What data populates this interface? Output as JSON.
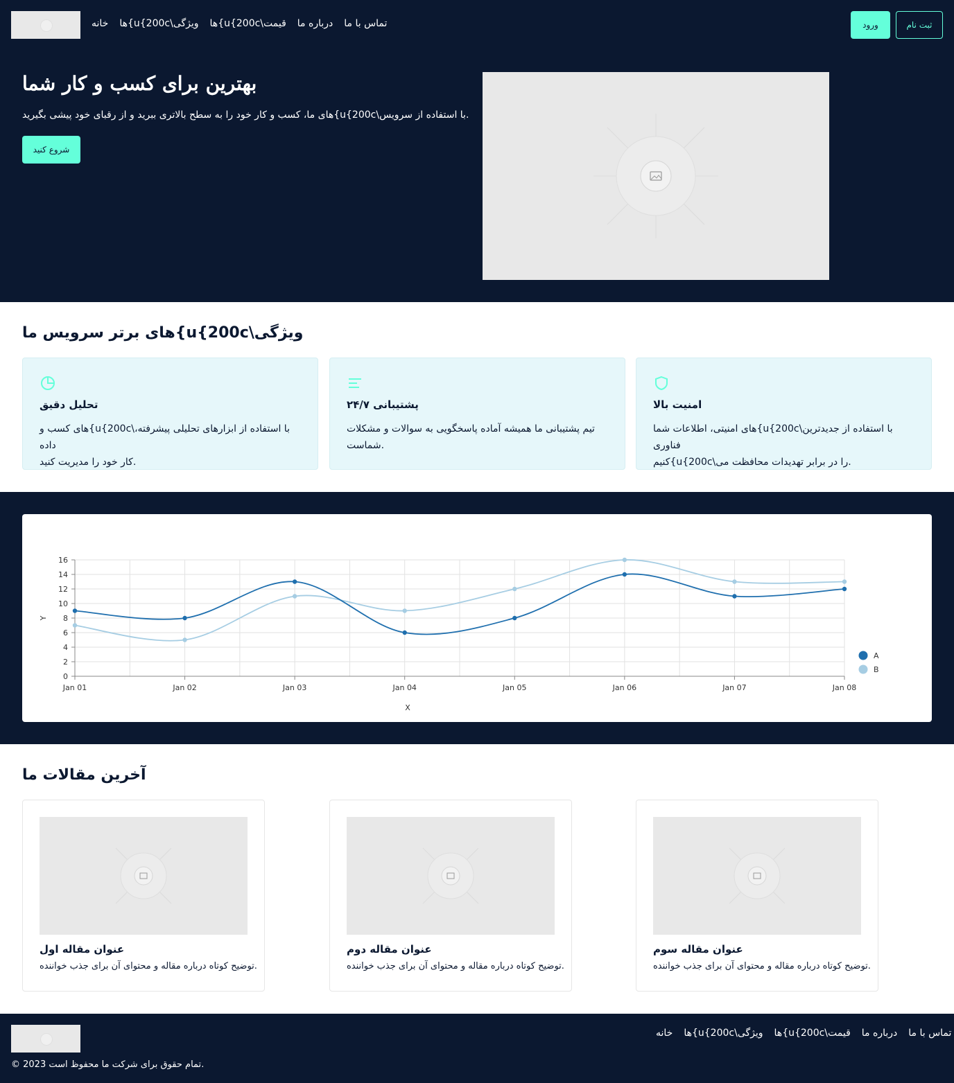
{
  "colors": {
    "navy": "#0b1830",
    "accent": "#64ffda",
    "card_bg": "#e6f7fa",
    "series_a": "#1f6fae",
    "series_b": "#a6cde3"
  },
  "nav": {
    "links": [
      "تماس با ما",
      "درباره ما",
      "ها{u{200c\\قیمت",
      "ها{u{200c\\ویژگی",
      "خانه"
    ],
    "login_label": "ورود",
    "signup_label": "ثبت نام"
  },
  "hero": {
    "title": "بهترین برای کسب و کار شما",
    "subtitle": "های ما، کسب و کار خود را به سطح بالاتری ببرید و از رقبای خود پیشی بگیرید{u{200c\\با استفاده از سرویس.",
    "cta_label": "شروع کنید",
    "image_icon": "image-placeholder-icon"
  },
  "features": {
    "title": "های برتر سرویس ما{u{200c\\ویژگی",
    "cards": [
      {
        "icon": "pie-chart-icon",
        "title": "تحلیل دقیق",
        "line1": "های کسب و{u{200c\\با استفاده از ابزارهای تحلیلی پیشرفته، داده",
        "line2": "کار خود را مدیریت کنید."
      },
      {
        "icon": "text-lines-icon",
        "title": "پشتیبانی ۲۴/۷",
        "line1": "تیم پشتیبانی ما همیشه آماده پاسخگویی به سوالات و مشکلات",
        "line2": "شماست."
      },
      {
        "icon": "shield-icon",
        "title": "امنیت بالا",
        "line1": "های امنیتی، اطلاعات شما{u{200c\\با استفاده از جدیدترین فناوری",
        "line2": "کنیم{u{200c\\را در برابر تهدیدات محافظت می."
      }
    ]
  },
  "chart_data": {
    "type": "line",
    "x": [
      "Jan 01",
      "Jan 02",
      "Jan 03",
      "Jan 04",
      "Jan 05",
      "Jan 06",
      "Jan 07",
      "Jan 08"
    ],
    "series": [
      {
        "name": "A",
        "values": [
          9,
          8,
          13,
          6,
          8,
          14,
          11,
          12
        ]
      },
      {
        "name": "B",
        "values": [
          7,
          5,
          11,
          9,
          12,
          16,
          13,
          13
        ]
      }
    ],
    "xlabel": "X",
    "ylabel": "Y",
    "ylim": [
      0,
      16
    ],
    "yticks": [
      0,
      2,
      4,
      6,
      8,
      10,
      12,
      14,
      16
    ],
    "grid": true,
    "legend": "right"
  },
  "articles": {
    "title": "آخرین مقالات ما",
    "items": [
      {
        "title": "عنوان مقاله اول",
        "desc": "توضیح کوتاه درباره مقاله و محتوای آن برای جذب خواننده."
      },
      {
        "title": "عنوان مقاله دوم",
        "desc": "توضیح کوتاه درباره مقاله و محتوای آن برای جذب خواننده."
      },
      {
        "title": "عنوان مقاله سوم",
        "desc": "توضیح کوتاه درباره مقاله و محتوای آن برای جذب خواننده."
      }
    ]
  },
  "footer": {
    "links": [
      "تماس با ما",
      "درباره ما",
      "ها{u{200c\\قیمت",
      "ها{u{200c\\ویژگی",
      "خانه"
    ],
    "copyright": "© 2023 تمام حقوق برای شرکت ما محفوظ است."
  }
}
